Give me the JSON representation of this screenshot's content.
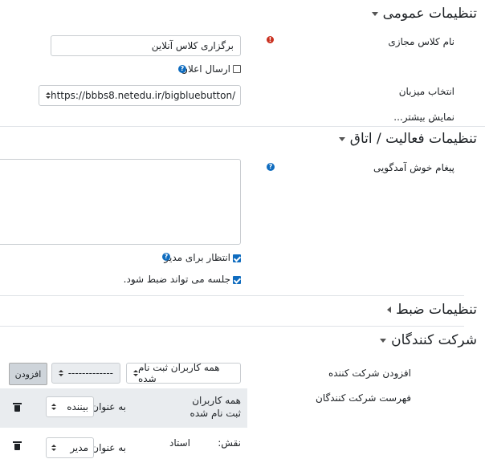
{
  "general": {
    "title": "تنظیمات عمومی",
    "class_name_label": "نام کلاس مجازی",
    "class_name_value": "برگزاری کلاس آنلاین",
    "send_notice_label": "ارسال اعلان",
    "host_label": "انتخاب میزبان",
    "host_value": "https://bbbs8.netedu.ir/bigbluebutton/",
    "show_more": "نمایش بیشتر..."
  },
  "activity": {
    "title": "تنظیمات فعالیت / اتاق",
    "welcome_label": "پیغام خوش آمدگویی",
    "wait_moderator_label": "انتظار برای مدیر",
    "can_record_label": "جلسه می تواند ضبط شود."
  },
  "recording": {
    "title": "تنظیمات ضبط"
  },
  "participants": {
    "title": "شرکت کنندگان",
    "add_label": "افزودن شرکت کننده",
    "add_select_value": "همه کاربران ثبت نام شده",
    "add_second_select": "-------------",
    "add_button": "افزودن",
    "list_label": "فهرست شرکت کنندگان",
    "row1_name_line1": "همه کاربران",
    "row1_name_line2": "ثبت نام شده",
    "row1_as": "به عنوان",
    "row1_role": "بیننده",
    "row2_name_prefix": "نقش:",
    "row2_name": "استاد",
    "row2_as": "به عنوان",
    "row2_role": "مدیر"
  },
  "colors": {
    "accent": "#0f6cbf",
    "required": "#ca3120"
  }
}
